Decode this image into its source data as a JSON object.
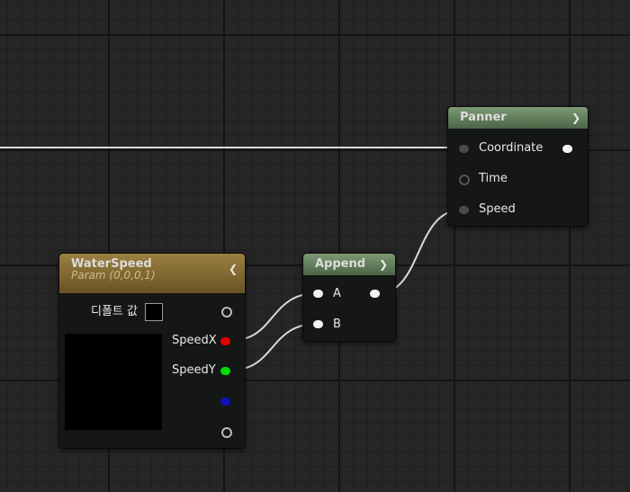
{
  "panner": {
    "title": "Panner",
    "pins": {
      "coordinate": "Coordinate",
      "time": "Time",
      "speed": "Speed"
    }
  },
  "append": {
    "title": "Append",
    "pins": {
      "a": "A",
      "b": "B"
    }
  },
  "water_speed": {
    "title": "WaterSpeed",
    "subtitle": "Param (0,0,0,1)",
    "default_value_label": "디폴트 값",
    "outputs": {
      "x": "SpeedX",
      "y": "SpeedY"
    }
  },
  "icons": {
    "collapse": "chevron-down-icon",
    "expand": "chevron-up-icon"
  },
  "colors": {
    "graph_bg": "#262626",
    "material_header": "#5d7a56",
    "param_header": "#8a7034",
    "pin_red": "#e00000",
    "pin_green": "#00e000",
    "pin_blue": "#1010c0"
  }
}
